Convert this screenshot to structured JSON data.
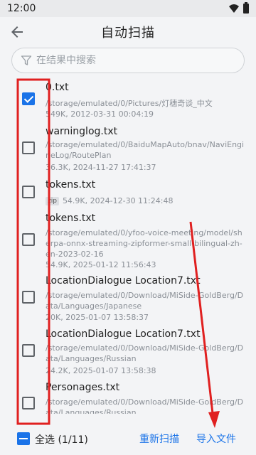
{
  "status_bar": {
    "time": "12:00"
  },
  "header": {
    "title": "自动扫描"
  },
  "search": {
    "placeholder": "在结果中搜索"
  },
  "files": [
    {
      "name": "0.txt",
      "path": "/storage/emulated/0/Pictures/灯穗奇谈_中文",
      "meta": "549K, 2012-03-31 00:04:19",
      "checked": true
    },
    {
      "name": "warninglog.txt",
      "path": "/storage/emulated/0/BaiduMapAuto/bnav/NaviEngineLog/RoutePlan",
      "meta": "36.3K, 2024-11-27 17:41:37",
      "checked": false
    },
    {
      "name": "tokens.txt",
      "badge": "zip",
      "meta": "54.9K, 2024-12-30 11:24:48",
      "checked": false
    },
    {
      "name": "tokens.txt",
      "path": "/storage/emulated/0/yfoo-voice-meeting/model/sherpa-onnx-streaming-zipformer-small-bilingual-zh-en-2023-02-16",
      "meta": "54.9K, 2025-01-12 11:56:43",
      "checked": false
    },
    {
      "name": "LocationDialogue Location7.txt",
      "path": "/storage/emulated/0/Download/MiSide-GoldBerg/Data/Languages/Japanese",
      "meta": "20K, 2025-01-07 13:58:37",
      "checked": false
    },
    {
      "name": "LocationDialogue Location7.txt",
      "path": "/storage/emulated/0/Download/MiSide-GoldBerg/Data/Languages/Russian",
      "meta": "24.2K, 2025-01-07 13:58:38",
      "checked": false
    },
    {
      "name": "Personages.txt",
      "path": "/storage/emulated/0/Download/MiSide-GoldBerg/Data/Languages/Russian",
      "meta": "",
      "checked": false
    }
  ],
  "bottom_bar": {
    "select_all_label": "全选 (1/11)",
    "rescan_label": "重新扫描",
    "import_label": "导入文件"
  },
  "colors": {
    "accent": "#1a73e8",
    "annotation": "#e02020"
  },
  "icons": {
    "back": "arrow-back-icon",
    "filter": "filter-icon",
    "wifi": "wifi-icon",
    "battery": "battery-icon"
  }
}
